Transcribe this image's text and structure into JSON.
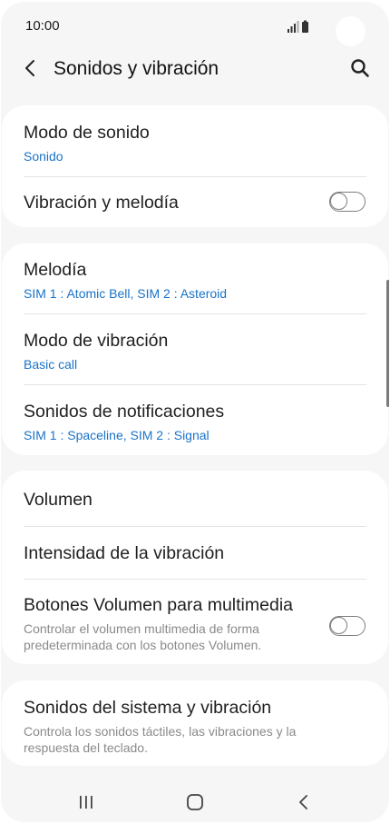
{
  "status": {
    "time": "10:00"
  },
  "header": {
    "title": "Sonidos y vibración"
  },
  "card1": {
    "modo_sonido": {
      "title": "Modo de sonido",
      "value": "Sonido"
    },
    "vibracion_melodia": {
      "title": "Vibración y melodía",
      "toggle_on": false
    }
  },
  "card2": {
    "melodia": {
      "title": "Melodía",
      "value": "SIM 1 : Atomic Bell, SIM 2 : Asteroid"
    },
    "modo_vibracion": {
      "title": "Modo de vibración",
      "value": "Basic call"
    },
    "sonidos_notificaciones": {
      "title": "Sonidos de notificaciones",
      "value": "SIM 1 : Spaceline, SIM 2 : Signal"
    }
  },
  "card3": {
    "volumen": {
      "title": "Volumen"
    },
    "intensidad": {
      "title": "Intensidad de la vibración"
    },
    "botones_volumen": {
      "title": "Botones Volumen para multimedia",
      "desc_line1": "Controlar el volumen multimedia de forma",
      "desc_line2": "predeterminada con los botones Volumen.",
      "toggle_on": false
    }
  },
  "card4": {
    "sonidos_sistema": {
      "title": "Sonidos del sistema y vibración",
      "desc_line1": "Controla los sonidos táctiles, las vibraciones y la",
      "desc_line2": "respuesta del teclado."
    }
  },
  "icons": {
    "back": "back-arrow-icon",
    "search": "search-icon",
    "nav_recents": "recents-icon",
    "nav_home": "home-icon",
    "nav_back": "nav-back-icon"
  },
  "colors": {
    "accent": "#1a73c7",
    "background": "#f6f6f6",
    "card": "#ffffff"
  }
}
